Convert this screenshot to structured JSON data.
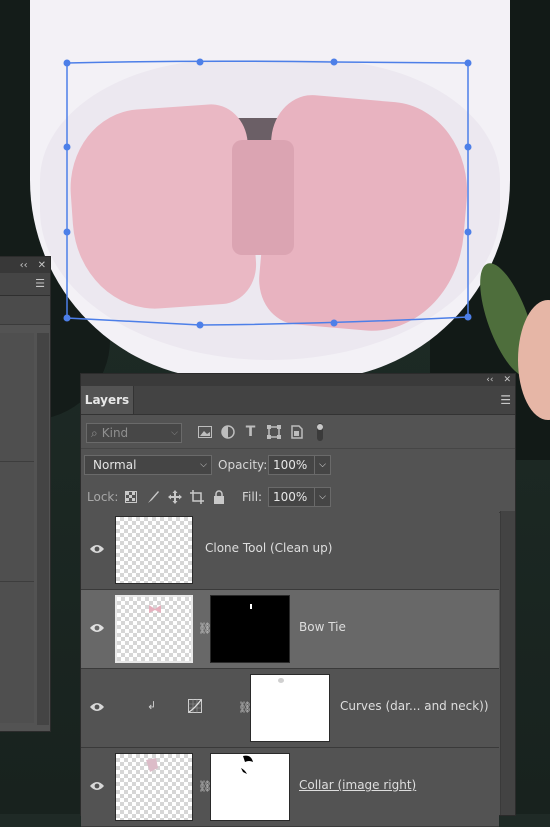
{
  "layers_panel": {
    "tab_label": "Layers",
    "filter": {
      "kind_label": "Kind",
      "icons": [
        "image-filter-icon",
        "adjustment-filter-icon",
        "type-filter-icon",
        "shape-filter-icon",
        "smart-object-filter-icon",
        "filter-toggle-icon"
      ]
    },
    "blend_mode": "Normal",
    "opacity_label": "Opacity:",
    "opacity_value": "100%",
    "lock_label": "Lock:",
    "lock_icons": [
      "lock-transparent-pixels-icon",
      "lock-image-pixels-icon",
      "lock-position-icon",
      "lock-artboard-icon",
      "lock-all-icon"
    ],
    "fill_label": "Fill:",
    "fill_value": "100%",
    "layers": [
      {
        "name": "Clone Tool (Clean up)",
        "visible": true,
        "selected": false
      },
      {
        "name": "Bow Tie",
        "visible": true,
        "selected": true,
        "has_mask": true
      },
      {
        "name": "Curves (dar... and neck))",
        "visible": true,
        "selected": false,
        "adjustment": "curves",
        "clipped": true
      },
      {
        "name": "Collar (image right)",
        "visible": true,
        "selected": false,
        "has_mask": true
      }
    ]
  },
  "colors": {
    "panel_bg": "#535353",
    "selected_row": "#686868",
    "transform_handles": "#4d7fe8"
  }
}
